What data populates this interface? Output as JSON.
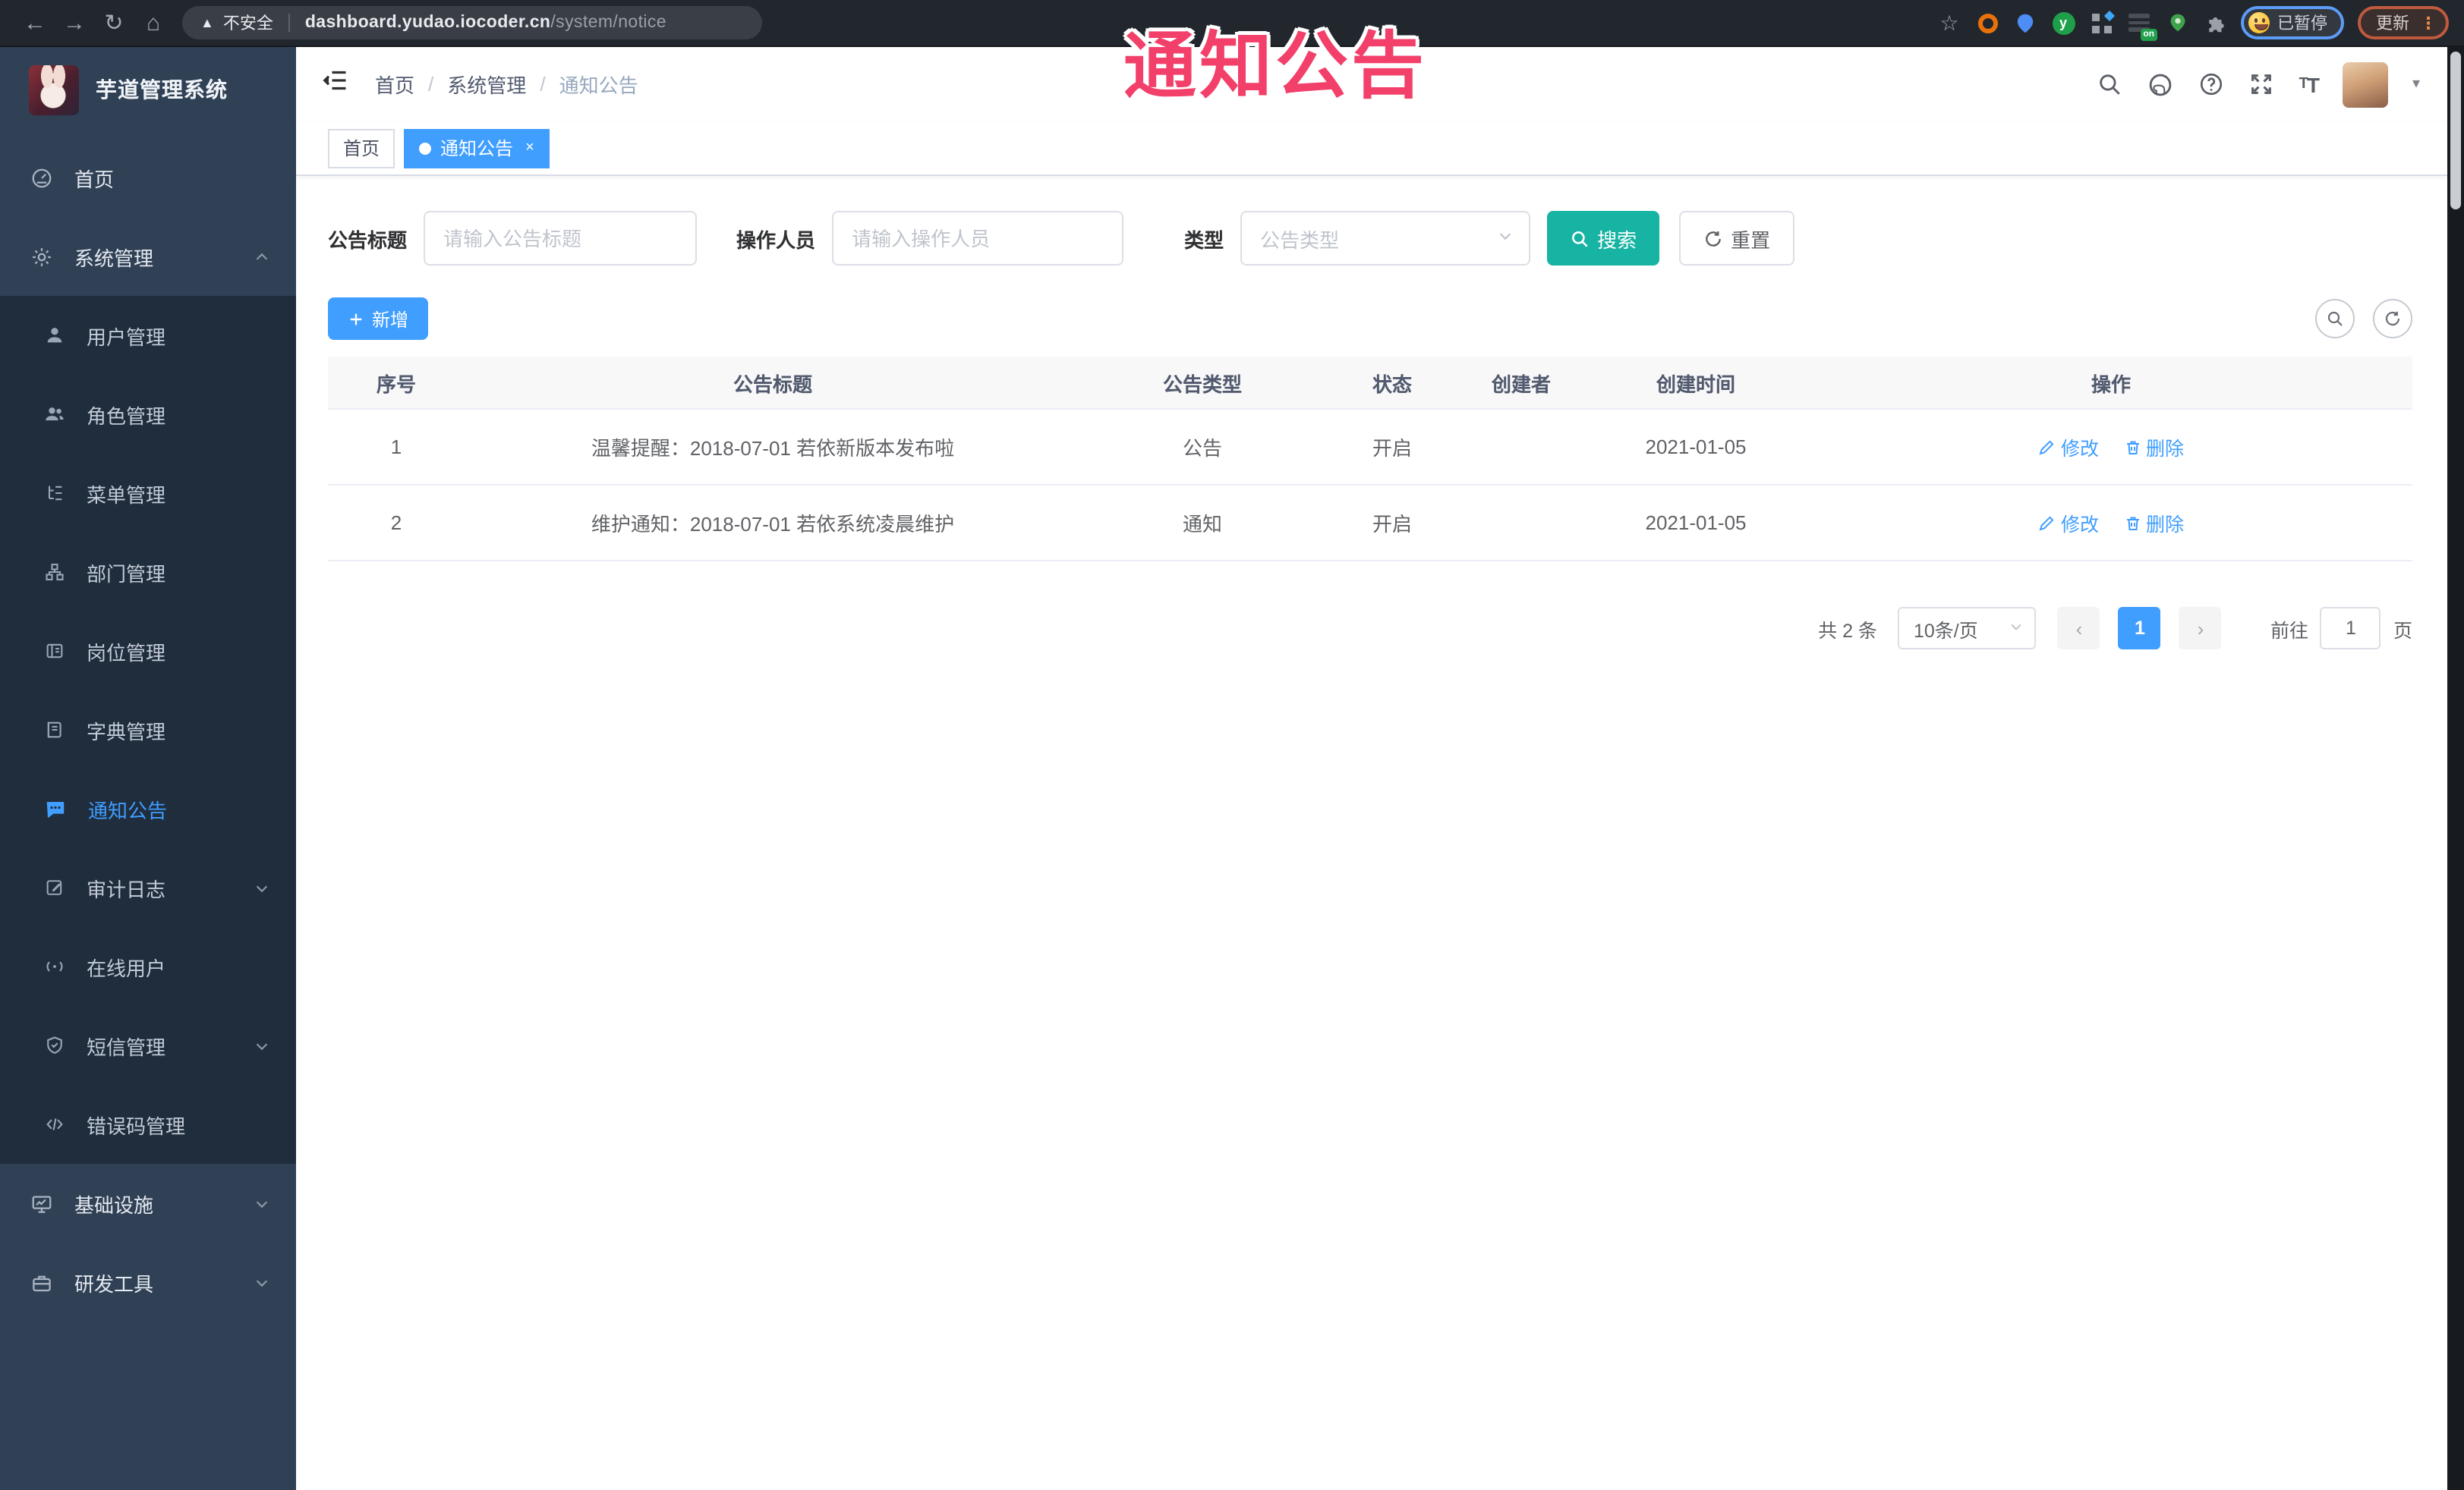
{
  "browser": {
    "not_secure": "不安全",
    "url_host": "dashboard.yudao.iocoder.cn",
    "url_path": "/system/notice",
    "profile_status": "已暂停",
    "update_label": "更新"
  },
  "watermark": "通知公告",
  "sidebar": {
    "title": "芋道管理系统",
    "home": "首页",
    "system": "系统管理",
    "sub_items": [
      "用户管理",
      "角色管理",
      "菜单管理",
      "部门管理",
      "岗位管理",
      "字典管理",
      "通知公告",
      "审计日志",
      "在线用户",
      "短信管理",
      "错误码管理"
    ],
    "bottom_items": [
      "基础设施",
      "研发工具"
    ]
  },
  "breadcrumb": {
    "items": [
      "首页",
      "系统管理",
      "通知公告"
    ],
    "separator": "/"
  },
  "tags": {
    "home": "首页",
    "active": "通知公告",
    "close": "×"
  },
  "filters": {
    "title_label": "公告标题",
    "title_placeholder": "请输入公告标题",
    "operator_label": "操作人员",
    "operator_placeholder": "请输入操作人员",
    "type_label": "类型",
    "type_placeholder": "公告类型",
    "search": "搜索",
    "reset": "重置"
  },
  "toolbar": {
    "add": "新增"
  },
  "table": {
    "headers": [
      "序号",
      "公告标题",
      "公告类型",
      "状态",
      "创建者",
      "创建时间",
      "操作"
    ],
    "rows": [
      {
        "no": "1",
        "title": "温馨提醒：2018-07-01 若依新版本发布啦",
        "type": "公告",
        "status": "开启",
        "creator": "",
        "created": "2021-01-05"
      },
      {
        "no": "2",
        "title": "维护通知：2018-07-01 若依系统凌晨维护",
        "type": "通知",
        "status": "开启",
        "creator": "",
        "created": "2021-01-05"
      }
    ],
    "actions": {
      "edit": "修改",
      "delete": "删除"
    }
  },
  "pagination": {
    "total": "共 2 条",
    "page_size": "10条/页",
    "current_page": "1",
    "goto_label": "前往",
    "goto_value": "1",
    "page_unit": "页"
  },
  "colors": {
    "accent": "#409EFF",
    "search_button": "#17B3A3",
    "sidebar_bg": "#304156",
    "submenu_bg": "#1F2D3D",
    "watermark": "#F2406A"
  }
}
